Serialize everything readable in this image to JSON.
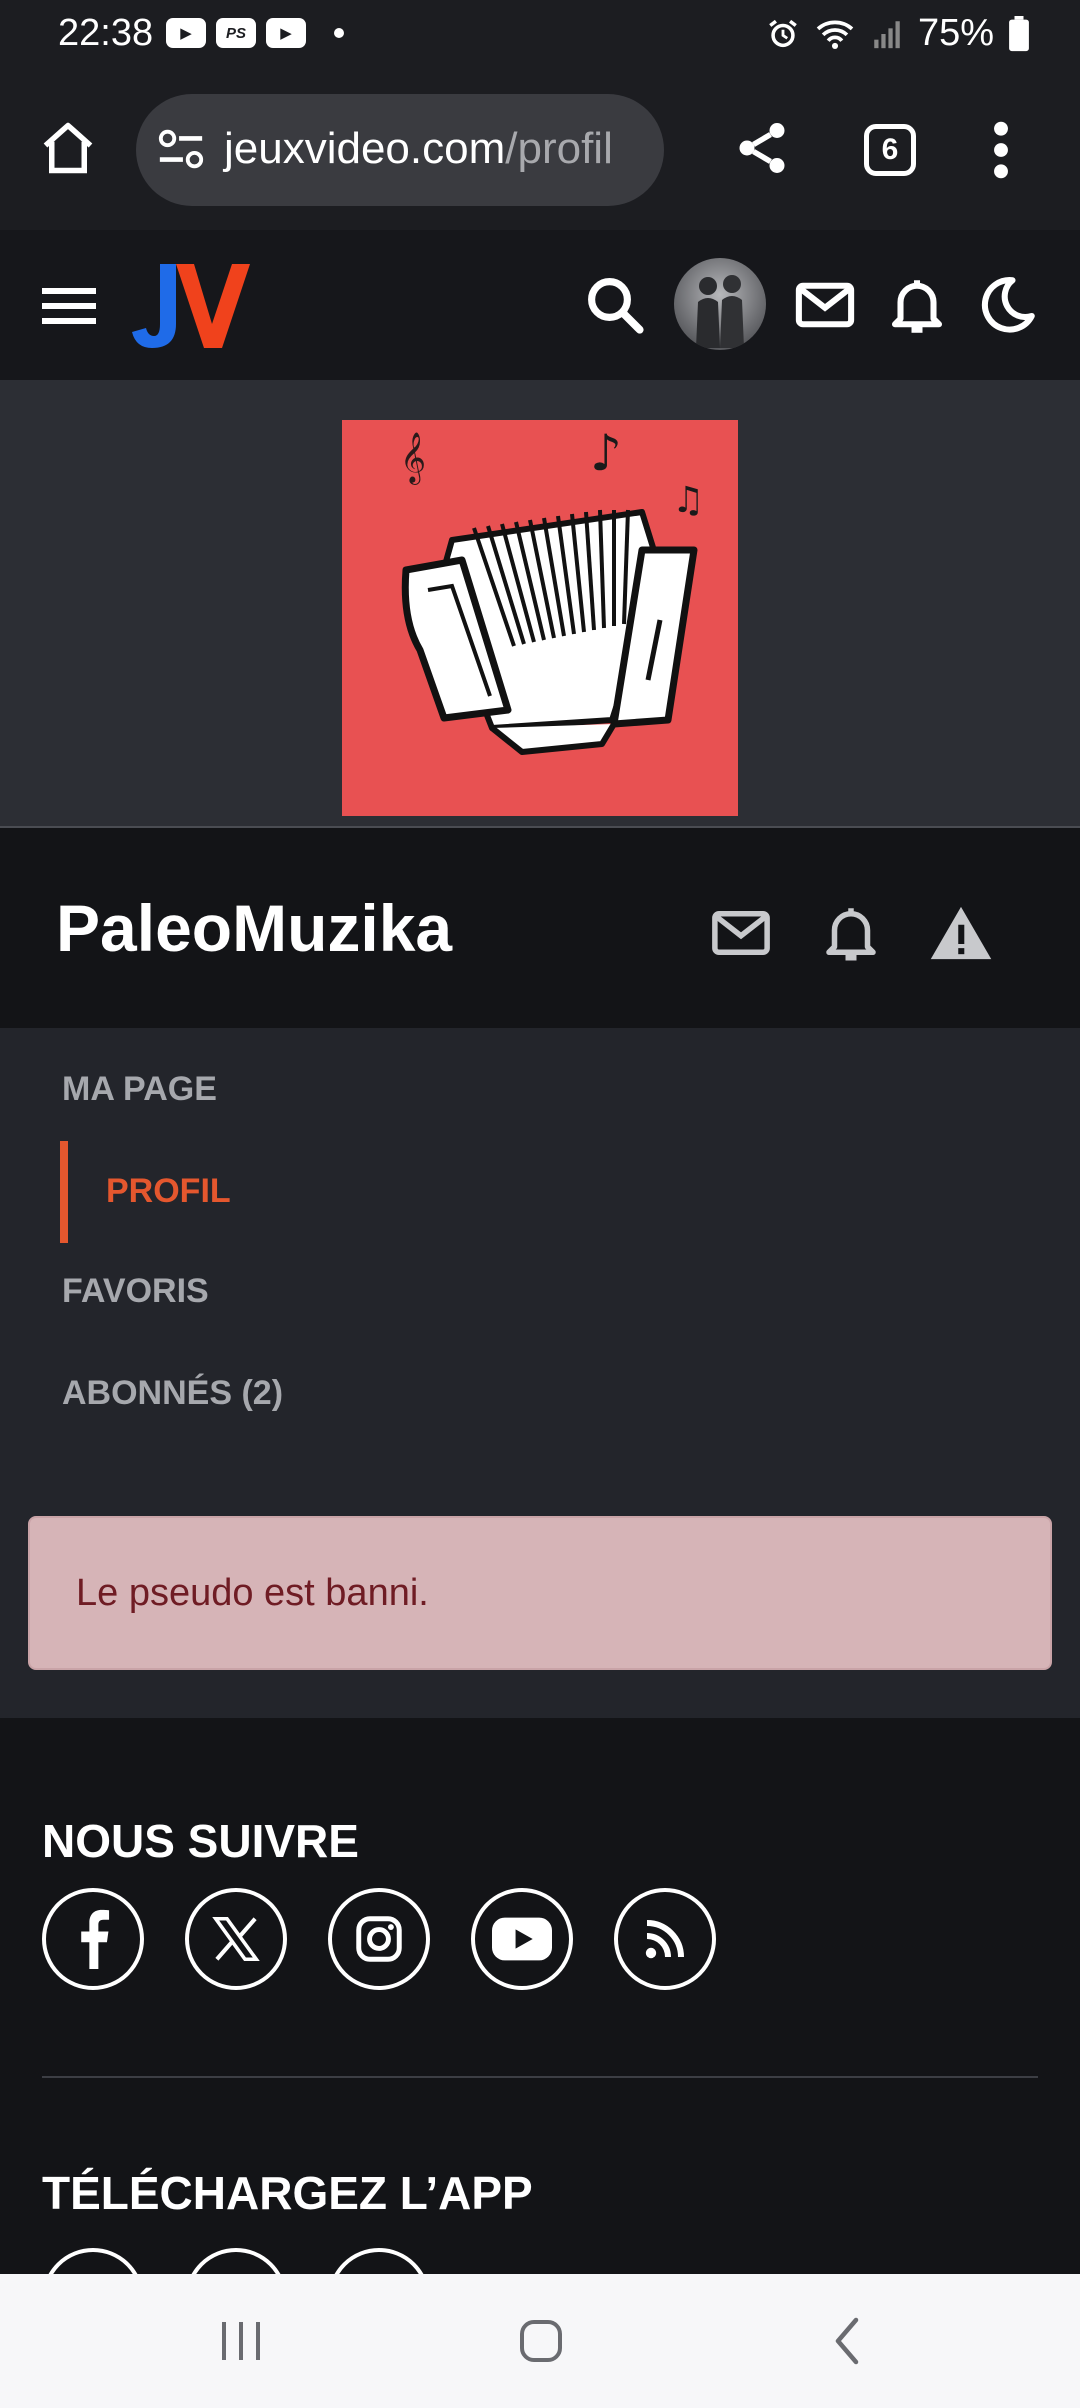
{
  "status_bar": {
    "time": "22:38",
    "ps_label": "PS",
    "battery": "75%"
  },
  "browser": {
    "url_domain": "jeuxvideo.com",
    "url_path": "/profil",
    "tab_count": "6"
  },
  "site": {
    "logo_text": "JV"
  },
  "profile": {
    "username": "PaleoMuzika"
  },
  "nav": {
    "items": [
      {
        "label": "MA PAGE"
      },
      {
        "label": "PROFIL"
      },
      {
        "label": "FAVORIS"
      },
      {
        "label": "ABONNÉS (2)"
      }
    ],
    "active": "PROFIL"
  },
  "alert": {
    "message": "Le pseudo est banni."
  },
  "footer": {
    "follow_title": "NOUS SUIVRE",
    "social": [
      "facebook-icon",
      "x-icon",
      "instagram-icon",
      "youtube-icon",
      "rss-icon"
    ],
    "app_title": "TÉLÉCHARGEZ L’APP"
  },
  "colors": {
    "accent": "#e4572e",
    "alert_bg": "#d6b4b7",
    "alert_text": "#6f1c24",
    "avatar_bg": "#e85152"
  }
}
